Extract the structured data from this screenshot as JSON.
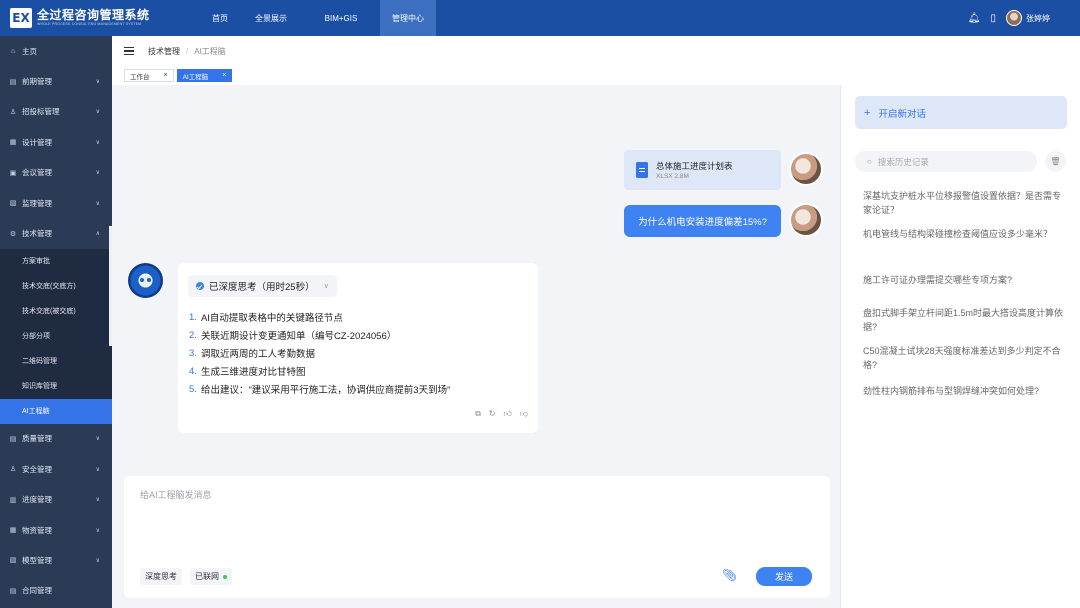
{
  "app": {
    "logo_mark": "EX",
    "title": "全过程咨询管理系统",
    "subtitle": "WHOLE PROCESS CONSULTING MANAGEMENT SYSTEM"
  },
  "topnav": [
    {
      "label": "首页"
    },
    {
      "label": "全景展示"
    },
    {
      "label": "BIM+GIS"
    },
    {
      "label": "管理中心"
    }
  ],
  "user": {
    "name": "张婷婷"
  },
  "sidebar": {
    "items": [
      {
        "label": "主页",
        "icon": "home-icon",
        "glyph": "⌂"
      },
      {
        "label": "前期管理",
        "icon": "calendar-icon",
        "glyph": "▤"
      },
      {
        "label": "招投标管理",
        "icon": "person-icon",
        "glyph": "♙"
      },
      {
        "label": "设计管理",
        "icon": "grid-icon",
        "glyph": "▦"
      },
      {
        "label": "会议管理",
        "icon": "meeting-icon",
        "glyph": "▣"
      },
      {
        "label": "监理管理",
        "icon": "monitor-icon",
        "glyph": "▧"
      },
      {
        "label": "技术管理",
        "icon": "tech-icon",
        "glyph": "⚙"
      }
    ],
    "sub_items": [
      {
        "label": "方案审批"
      },
      {
        "label": "技术交底(交底方)"
      },
      {
        "label": "技术交底(被交底)"
      },
      {
        "label": "分部分项"
      },
      {
        "label": "二维码管理"
      },
      {
        "label": "知识库管理"
      },
      {
        "label": "AI工程脑"
      }
    ],
    "items_after": [
      {
        "label": "质量管理",
        "icon": "quality-icon",
        "glyph": "▤"
      },
      {
        "label": "安全管理",
        "icon": "safety-icon",
        "glyph": "♙"
      },
      {
        "label": "进度管理",
        "icon": "progress-icon",
        "glyph": "▥"
      },
      {
        "label": "物资管理",
        "icon": "material-icon",
        "glyph": "▦"
      },
      {
        "label": "模型管理",
        "icon": "model-icon",
        "glyph": "▧"
      },
      {
        "label": "合同管理",
        "icon": "contract-icon",
        "glyph": "▤"
      }
    ]
  },
  "breadcrumb": {
    "parent": "技术管理",
    "separator": "/",
    "current": "AI工程脑"
  },
  "tabs": [
    {
      "label": "工作台"
    },
    {
      "label": "AI工程脑"
    }
  ],
  "chat": {
    "file": {
      "name": "总体施工进度计划表",
      "meta": "XLSX 2.8M"
    },
    "user_message": "为什么机电安装进度偏差15%?",
    "thinking_label": "已深度思考（用时25秒）",
    "steps": [
      {
        "num": "1.",
        "text": "AI自动提取表格中的关键路径节点"
      },
      {
        "num": "2.",
        "text": "关联近期设计变更通知单（编号CZ-2024056）"
      },
      {
        "num": "3.",
        "text": "调取近两周的工人考勤数据"
      },
      {
        "num": "4.",
        "text": "生成三维进度对比甘特图"
      },
      {
        "num": "5.",
        "text": "给出建议：\"建议采用平行施工法，协调供应商提前3天到场\""
      }
    ],
    "composer_placeholder": "给AI工程脑发消息",
    "deep_think_label": "深度思考",
    "online_label": "已联网",
    "send_label": "发送"
  },
  "right_panel": {
    "new_chat_label": "开启新对话",
    "search_placeholder": "搜索历史记录",
    "history": [
      "深基坑支护桩水平位移报警值设置依据？是否需专家论证？",
      "机电管线与结构梁碰撞检查阈值应设多少毫米？",
      "施工许可证办理需提交哪些专项方案?",
      "盘扣式脚手架立杆间距1.5m时最大搭设高度计算依据?",
      "C50混凝土试块28天强度标准差达到多少判定不合格?",
      "劲性柱内钢筋排布与型钢焊缝冲突如何处理?"
    ]
  },
  "colors": {
    "topbar": "#1a4fa3",
    "sidebar": "#2b3a55",
    "accent": "#3574e8"
  }
}
